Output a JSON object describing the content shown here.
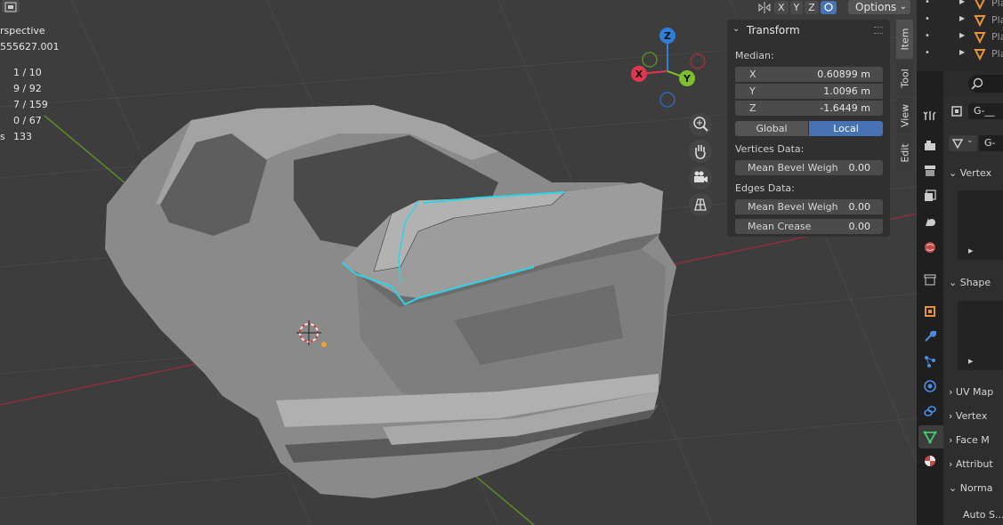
{
  "viewport": {
    "overlay": {
      "view_name": "rspective",
      "object_name": "555627.001"
    },
    "stats": [
      {
        "label": "",
        "value": "1 / 10"
      },
      {
        "label": "",
        "value": "9 / 92"
      },
      {
        "label": "",
        "value": "7 / 159"
      },
      {
        "label": "",
        "value": "0 / 67"
      },
      {
        "label": "s",
        "value": "133"
      }
    ],
    "header": {
      "axis_x": "X",
      "axis_y": "Y",
      "axis_z": "Z",
      "options_label": "Options"
    },
    "gizmo": {
      "z": "Z",
      "y": "Y",
      "x": "X"
    },
    "nav_icons": [
      "zoom-icon",
      "hand-icon",
      "camera-icon",
      "grid-icon"
    ]
  },
  "sidebar": {
    "title": "Transform",
    "median_label": "Median:",
    "median": [
      {
        "axis": "X",
        "value": "0.60899 m"
      },
      {
        "axis": "Y",
        "value": "1.0096 m"
      },
      {
        "axis": "Z",
        "value": "-1.6449 m"
      }
    ],
    "space": {
      "global": "Global",
      "local": "Local",
      "selected": "Local"
    },
    "vertices_data_label": "Vertices Data:",
    "vertex_bevel": {
      "label": "Mean Bevel Weigh",
      "value": "0.00"
    },
    "edges_data_label": "Edges Data:",
    "edge_bevel": {
      "label": "Mean Bevel Weigh",
      "value": "0.00"
    },
    "edge_crease": {
      "label": "Mean Crease",
      "value": "0.00"
    },
    "tabs": [
      "Item",
      "Tool",
      "View",
      "Edit"
    ],
    "active_tab": "Item"
  },
  "outliner": {
    "rows": [
      "Pla",
      "Pla",
      "Pla",
      "Pla"
    ]
  },
  "properties": {
    "object_name": "G-__",
    "data_name": "G-__",
    "sections": [
      "Vertex",
      "Shape",
      "UV Map",
      "Vertex",
      "Face M",
      "Attribut",
      "Norma"
    ],
    "auto_smooth": "Auto S..."
  },
  "colors": {
    "accent": "#4772b3",
    "selected_edge": "#2fd3e6",
    "axis_x": "#e0354e",
    "axis_y": "#7ec02c",
    "axis_z": "#2e7fd9"
  }
}
